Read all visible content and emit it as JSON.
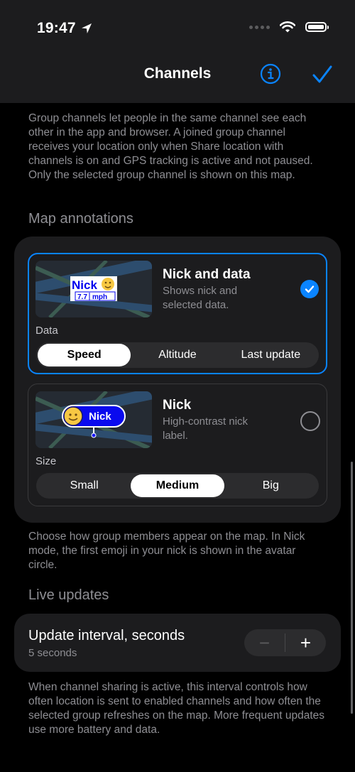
{
  "status": {
    "time": "19:47"
  },
  "nav": {
    "title": "Channels"
  },
  "intro_text": "Group channels let people in the same channel see each other in the app and browser. A joined group channel receives your location only when Share location with channels is on and GPS tracking is active and not paused. Only the selected group channel is shown on this map.",
  "map_annotations": {
    "header": "Map annotations",
    "options": [
      {
        "title": "Nick and data",
        "subtitle": "Shows nick and selected data.",
        "selected": true,
        "preview": {
          "nick": "Nick",
          "value": "7.7",
          "unit": "mph"
        },
        "control_label": "Data",
        "segments": [
          "Speed",
          "Altitude",
          "Last update"
        ],
        "selected_segment": "Speed"
      },
      {
        "title": "Nick",
        "subtitle": "High-contrast nick label.",
        "selected": false,
        "preview": {
          "nick": "Nick"
        },
        "control_label": "Size",
        "segments": [
          "Small",
          "Medium",
          "Big"
        ],
        "selected_segment": "Medium"
      }
    ],
    "footer": "Choose how group members appear on the map. In Nick mode, the first emoji in your nick is shown in the avatar circle."
  },
  "live_updates": {
    "header": "Live updates",
    "interval_title": "Update interval, seconds",
    "interval_value": "5 seconds",
    "minus_symbol": "−",
    "plus_symbol": "+",
    "footer": "When channel sharing is active, this interval controls how often location is sent to enabled channels and how often the selected group refreshes on the map. More frequent updates use more battery and data."
  },
  "colors": {
    "accent": "#0a84ff",
    "background": "#000000",
    "card": "#1c1c1e"
  },
  "icons": [
    "location-arrow-icon",
    "cellular-icon",
    "wifi-icon",
    "battery-icon",
    "info-icon",
    "checkmark-icon",
    "smiley-icon"
  ]
}
